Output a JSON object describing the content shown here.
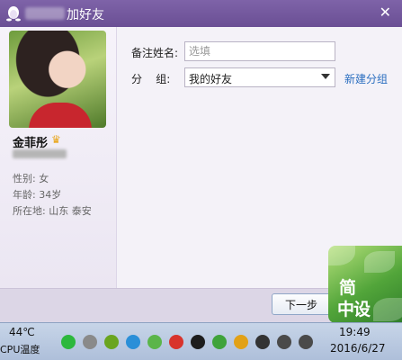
{
  "window": {
    "title": "加好友",
    "close_glyph": "✕"
  },
  "profile": {
    "name": "金菲彤",
    "gender_label": "性别: ",
    "gender": "女",
    "age_label": "年龄: ",
    "age": "34岁",
    "location_label": "所在地: ",
    "location": "山东  泰安"
  },
  "form": {
    "remark_label": "备注姓名:",
    "remark_placeholder": "选填",
    "remark_value": "",
    "group_label": "分    组:",
    "group_selected": "我的好友",
    "new_group_link": "新建分组"
  },
  "footer": {
    "next_button": "下一步"
  },
  "watermark": {
    "line1": "简",
    "line2": "中设"
  },
  "taskbar": {
    "temperature": "44℃",
    "cpu_label": "CPU温度",
    "time": "19:49",
    "date": "2016/6/27",
    "tray_icons": [
      {
        "name": "wechat-icon",
        "color": "#2db83d"
      },
      {
        "name": "people-icon",
        "color": "#8a8a8a"
      },
      {
        "name": "nvidia-icon",
        "color": "#6aa51f"
      },
      {
        "name": "play-icon",
        "color": "#2a8fd8"
      },
      {
        "name": "green-app-icon",
        "color": "#5bb54a"
      },
      {
        "name": "netease-music-icon",
        "color": "#d8332c"
      },
      {
        "name": "qq-icon",
        "color": "#1d1d1d"
      },
      {
        "name": "shield-icon",
        "color": "#3fa33a"
      },
      {
        "name": "plus-icon",
        "color": "#e2a116"
      },
      {
        "name": "bird-icon",
        "color": "#333333"
      },
      {
        "name": "volume-icon",
        "color": "#4a4a4a"
      },
      {
        "name": "network-icon",
        "color": "#4a4a4a"
      }
    ]
  }
}
